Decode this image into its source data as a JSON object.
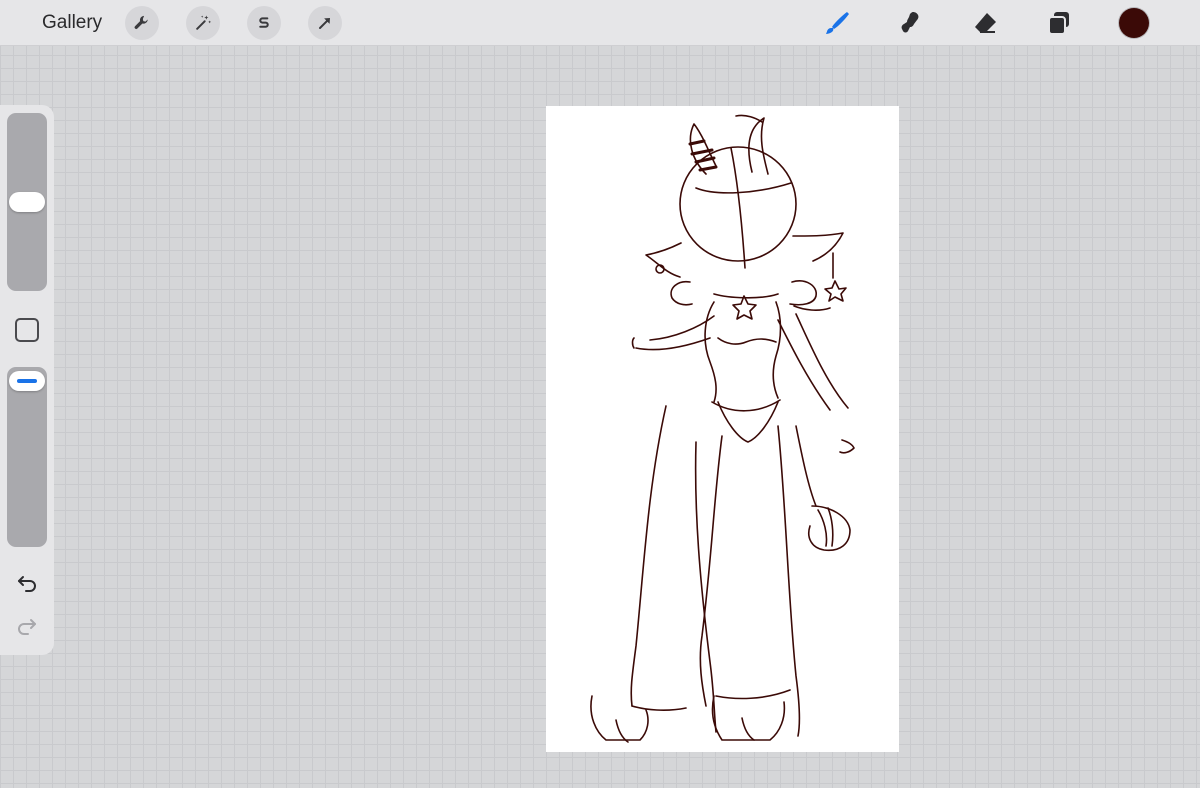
{
  "topbar": {
    "gallery_label": "Gallery",
    "left_tools": [
      "wrench-icon",
      "magic-wand-icon",
      "selection-s-icon",
      "transform-arrow-icon"
    ],
    "right_tools": [
      "brush-icon",
      "smudge-icon",
      "eraser-icon",
      "layers-icon"
    ],
    "current_color": "#3b0a07",
    "brush_accent": "#1a73e8"
  },
  "sidebar": {
    "brush_size_level": 0.5,
    "brush_opacity_level": 1.0,
    "undo_icon": "undo-icon",
    "redo_icon": "redo-icon"
  },
  "canvas": {
    "background": "#ffffff",
    "stroke_color": "#3b0a07"
  }
}
